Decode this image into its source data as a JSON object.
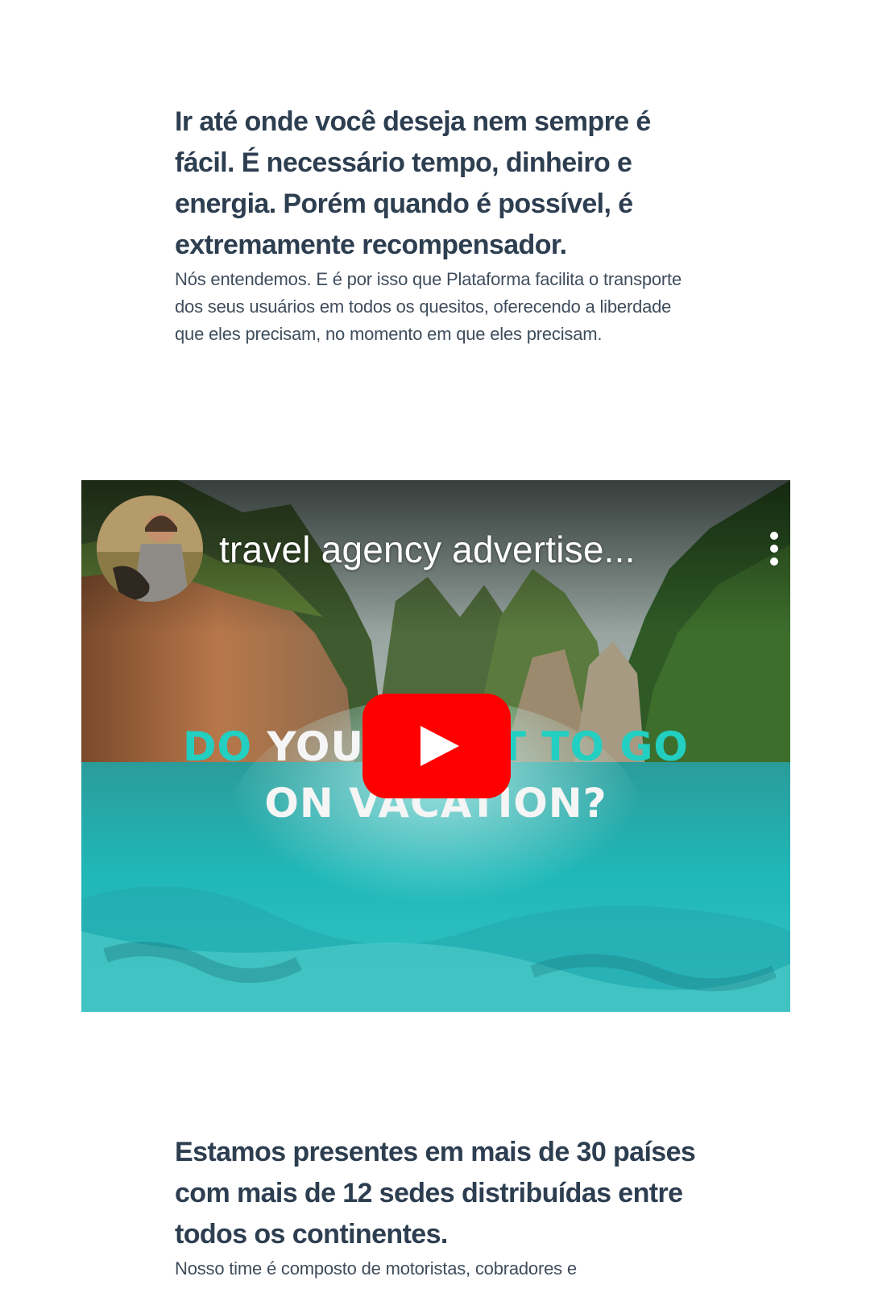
{
  "intro": {
    "headline": "Ir até onde você deseja nem sempre é fácil. É necessário tempo, dinheiro e energia. Porém quando é possível, é extremamente recompensador.",
    "body": "Nós entendemos. E é por isso que Plataforma facilita o transporte dos seus usuários em todos os quesitos, oferecendo a liberdade que eles precisam, no momento em que eles precisam."
  },
  "video": {
    "title": "travel agency advertise...",
    "overlay_line1_part1": "DO",
    "overlay_line1_part2": "YOU",
    "overlay_line1_part3": "T TO GO",
    "overlay_line2": "ON VACATION?",
    "avatar_icon": "channel-avatar",
    "more_icon": "vertical-ellipsis",
    "play_icon": "youtube-play",
    "colors": {
      "play_button": "#ff0000",
      "overlay_accent": "#22cfc1",
      "water": "#1fb7b8"
    }
  },
  "presence": {
    "headline": "Estamos presentes em mais de 30 países com mais de 12 sedes distribuídas entre todos os continentes.",
    "body": "Nosso time é composto de motoristas, cobradores e"
  }
}
